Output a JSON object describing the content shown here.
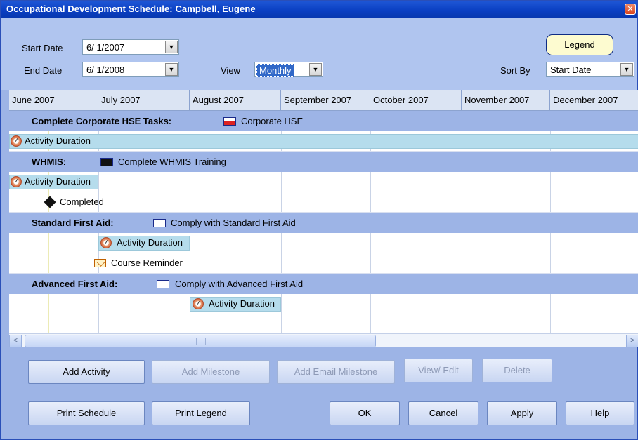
{
  "window": {
    "title": "Occupational Development Schedule: Campbell, Eugene",
    "close_glyph": "✕"
  },
  "filters": {
    "start_date_label": "Start Date",
    "start_date_value": "6/ 1/2007",
    "end_date_label": "End Date",
    "end_date_value": "6/ 1/2008",
    "view_label": "View",
    "view_value": "Monthly",
    "sort_label": "Sort By",
    "sort_value": "Start Date",
    "legend_label": "Legend"
  },
  "months": [
    "June 2007",
    "July 2007",
    "August 2007",
    "September 2007",
    "October 2007",
    "November 2007",
    "December 2007"
  ],
  "groups": [
    {
      "title": "Complete Corporate HSE Tasks:",
      "subtitle": "Corporate HSE",
      "icon": "flag-icon"
    },
    {
      "title": "WHMIS:",
      "subtitle": "Complete WHMIS Training",
      "icon": "flag-icon"
    },
    {
      "title": "Standard First Aid:",
      "subtitle": "Comply with Standard First Aid",
      "icon": "flag-icon"
    },
    {
      "title": "Advanced First Aid:",
      "subtitle": "Comply with Advanced First Aid",
      "icon": "flag-icon"
    }
  ],
  "items": {
    "corporate_duration": "Activity Duration",
    "whmis_duration": "Activity Duration",
    "whmis_completed": "Completed",
    "standard_duration": "Activity Duration",
    "standard_reminder": "Course Reminder",
    "advanced_duration": "Activity Duration"
  },
  "scrollbar": {
    "left_arrow": "<",
    "right_arrow": ">",
    "grip": "III"
  },
  "buttons": {
    "add_activity": "Add Activity",
    "add_milestone": "Add Milestone",
    "add_email_milestone": "Add Email Milestone",
    "view_edit": "View/ Edit",
    "delete": "Delete",
    "print_schedule": "Print Schedule",
    "print_legend": "Print Legend",
    "ok": "OK",
    "cancel": "Cancel",
    "apply": "Apply",
    "help": "Help"
  },
  "colors": {
    "title_bar": "#0a3fc2",
    "panel": "#9db4e6",
    "group_row": "#9db4e6",
    "duration_bar": "#b5dcec",
    "legend_button": "#fdfbd0"
  }
}
